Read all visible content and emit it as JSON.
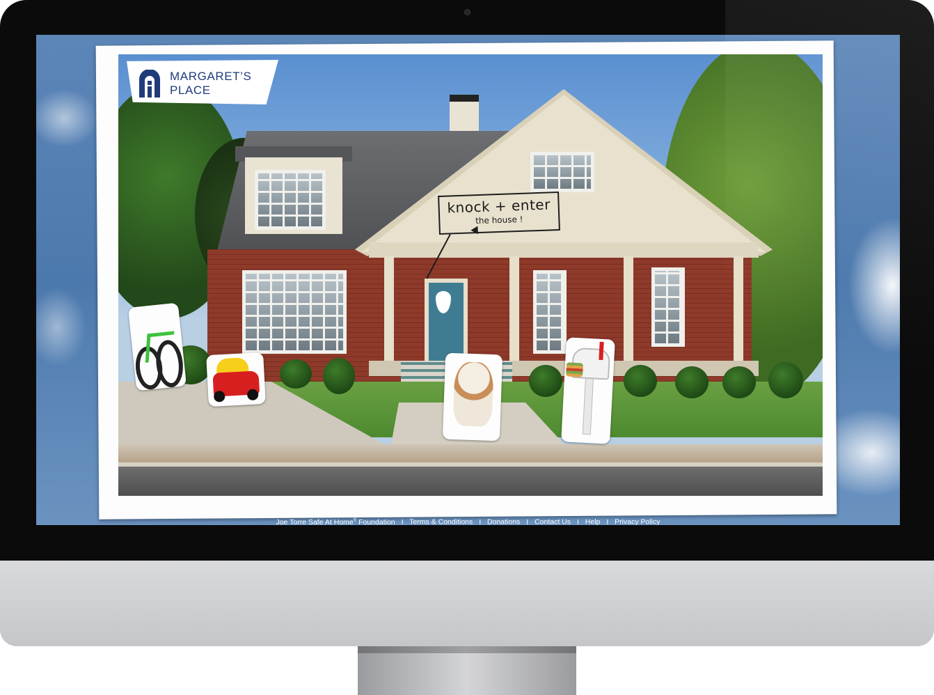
{
  "site": {
    "logo": {
      "line1": "MARGARET’S",
      "line2": "PLACE",
      "icon": "arched-door-icon"
    },
    "sign": {
      "main": "knock + enter",
      "sub": "the house !"
    }
  },
  "footer": {
    "links": [
      {
        "label": "Joe Torre Safe At Home",
        "sup": "®",
        "suffix": " Foundation"
      },
      {
        "label": "Terms & Conditions"
      },
      {
        "label": "Donations"
      },
      {
        "label": "Contact Us"
      },
      {
        "label": "Help"
      },
      {
        "label": "Privacy Policy"
      }
    ],
    "separator": "I"
  },
  "colors": {
    "logo_blue": "#1f3b7a",
    "sky": "#4c79ad",
    "door_teal": "#3f7c92",
    "brick_red": "#8e3a2a",
    "bezel": "#0b0b0b",
    "chin_silver": "#c5c6c9"
  },
  "props": [
    "bicycle",
    "toy-car",
    "bulldog",
    "mailbox"
  ]
}
